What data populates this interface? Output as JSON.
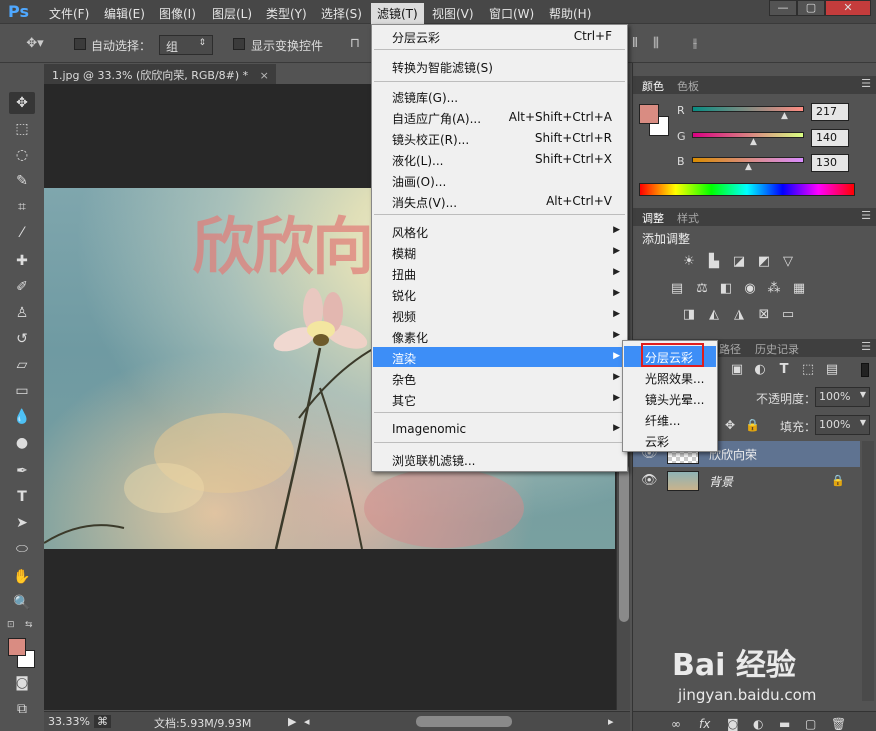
{
  "app": {
    "logo": "Ps"
  },
  "menubar": {
    "items": [
      "文件(F)",
      "编辑(E)",
      "图像(I)",
      "图层(L)",
      "类型(Y)",
      "选择(S)",
      "滤镜(T)",
      "视图(V)",
      "窗口(W)",
      "帮助(H)"
    ],
    "active": "滤镜(T)",
    "window_buttons": [
      "—",
      "▢",
      "✕"
    ]
  },
  "options_bar": {
    "auto_select_label": "自动选择：",
    "auto_select_value": "组",
    "show_transform_label": "显示变换控件"
  },
  "document": {
    "tab_title": "1.jpg @ 33.3% (欣欣向荣, RGB/8#) *",
    "tab_close": "×",
    "image_text": "欣欣向"
  },
  "status": {
    "zoom": "33.33%",
    "doc_size": "文档:5.93M/9.93M"
  },
  "filter_menu": {
    "items": [
      {
        "label": "分层云彩",
        "shortcut": "Ctrl+F"
      },
      {
        "label": "转换为智能滤镜(S)"
      },
      {
        "label": "滤镜库(G)..."
      },
      {
        "label": "自适应广角(A)...",
        "shortcut": "Alt+Shift+Ctrl+A"
      },
      {
        "label": "镜头校正(R)...",
        "shortcut": "Shift+Ctrl+R"
      },
      {
        "label": "液化(L)...",
        "shortcut": "Shift+Ctrl+X"
      },
      {
        "label": "油画(O)..."
      },
      {
        "label": "消失点(V)...",
        "shortcut": "Alt+Ctrl+V"
      },
      {
        "label": "风格化",
        "submenu": true
      },
      {
        "label": "模糊",
        "submenu": true
      },
      {
        "label": "扭曲",
        "submenu": true
      },
      {
        "label": "锐化",
        "submenu": true
      },
      {
        "label": "视频",
        "submenu": true
      },
      {
        "label": "像素化",
        "submenu": true
      },
      {
        "label": "渲染",
        "submenu": true,
        "highlighted": true
      },
      {
        "label": "杂色",
        "submenu": true
      },
      {
        "label": "其它",
        "submenu": true
      },
      {
        "label": "Imagenomic",
        "submenu": true
      },
      {
        "label": "浏览联机滤镜..."
      }
    ]
  },
  "render_submenu": {
    "items": [
      "分层云彩",
      "光照效果...",
      "镜头光晕...",
      "纤维...",
      "云彩"
    ],
    "highlighted": "分层云彩"
  },
  "color_panel": {
    "tabs": [
      "颜色",
      "色板"
    ],
    "channels": [
      {
        "name": "R",
        "value": "217"
      },
      {
        "name": "G",
        "value": "140"
      },
      {
        "name": "B",
        "value": "130"
      }
    ],
    "foreground": "#d98c82"
  },
  "adjust_panel": {
    "tabs": [
      "调整",
      "样式"
    ],
    "title": "添加调整"
  },
  "layers_panel": {
    "tabs": [
      "路径",
      "历史记录"
    ],
    "opacity_label": "不透明度：",
    "opacity_value": "100%",
    "fill_label": "填充：",
    "fill_value": "100%",
    "layers": [
      {
        "name": "欣欣向荣",
        "selected": true
      },
      {
        "name": "背景",
        "locked": true
      }
    ]
  },
  "watermark": {
    "brand": "Bai 经验",
    "url": "jingyan.baidu.com"
  },
  "colors": {
    "menu_highlight": "#3d8ef7",
    "annotation_red": "#e01d1d",
    "foreground_swatch": "#d98c82"
  }
}
